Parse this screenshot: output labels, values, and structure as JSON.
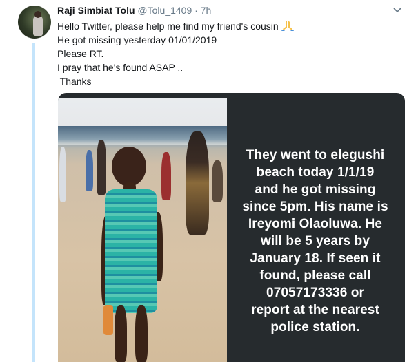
{
  "tweet": {
    "author_name": "Raji Simbiat Tolu",
    "handle": "@Tolu_1409",
    "separator": "·",
    "time": "7h",
    "lines": [
      "Hello Twitter, please help me find my friend's cousin",
      "He got missing yesterday 01/01/2019",
      "Please RT.",
      "I pray that he's found ASAP ..",
      " Thanks"
    ],
    "emoji_icon": "folded-hands-icon",
    "menu_icon": "chevron-down-icon"
  },
  "media": {
    "overlay_lines": [
      "They went to elegushi",
      "beach today 1/1/19",
      "and he got missing",
      "since 5pm. His name is",
      "Ireyomi Olaoluwa.  He",
      "will be 5 years by",
      "January 18. If seen it",
      "found, please call",
      "07057173336 or",
      "report at the nearest",
      "police station."
    ]
  },
  "colors": {
    "name": "#14171a",
    "secondary": "#657786",
    "thread_line": "#c4e4fb",
    "media_bg": "#262b2e"
  }
}
